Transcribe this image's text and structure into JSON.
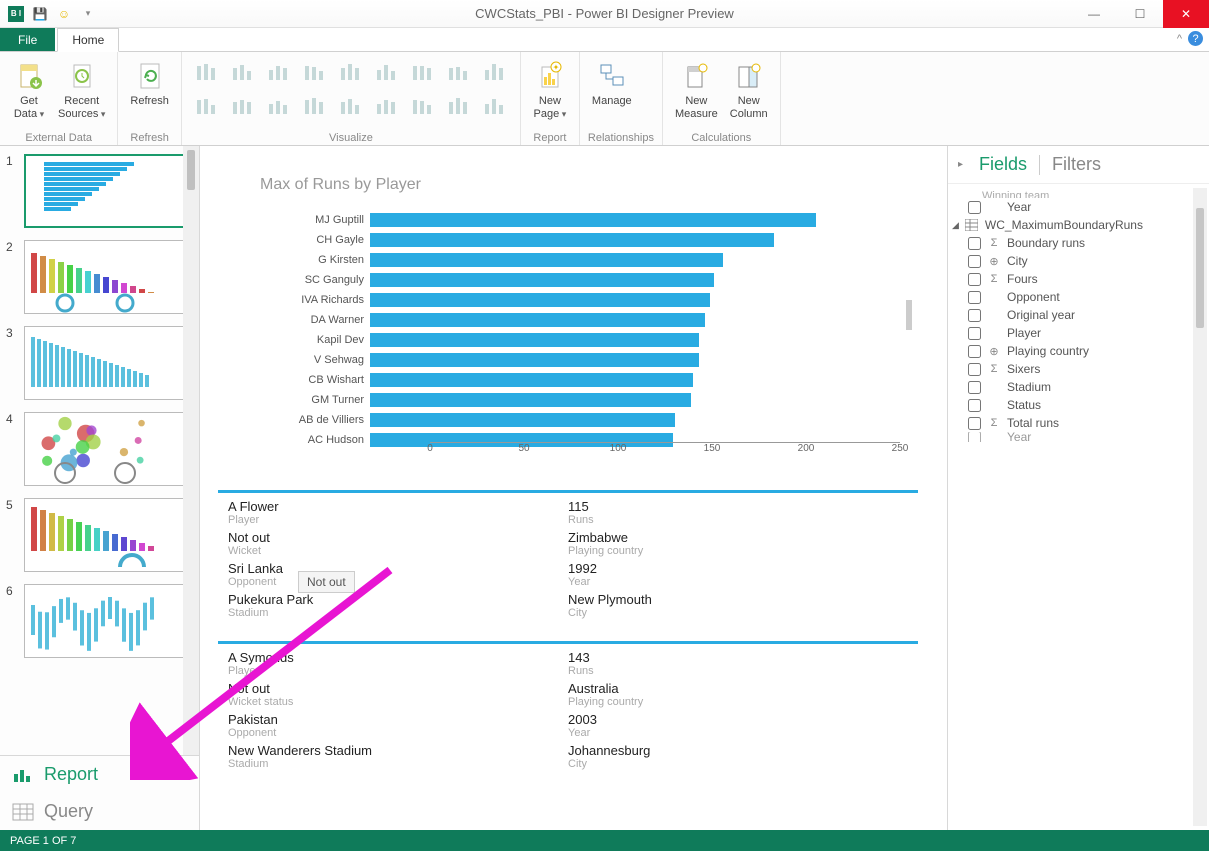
{
  "window": {
    "title": "CWCStats_PBI - Power BI Designer Preview"
  },
  "tabs": {
    "file": "File",
    "home": "Home"
  },
  "ribbon": {
    "external_data": {
      "label": "External Data",
      "get_data": "Get\nData",
      "recent_sources": "Recent\nSources"
    },
    "refresh": {
      "label": "Refresh",
      "btn": "Refresh"
    },
    "visualize": {
      "label": "Visualize"
    },
    "report": {
      "label": "Report",
      "new_page": "New\nPage"
    },
    "relationships": {
      "label": "Relationships",
      "manage": "Manage"
    },
    "calculations": {
      "label": "Calculations",
      "new_measure": "New\nMeasure",
      "new_column": "New\nColumn"
    }
  },
  "left_tabs": {
    "report": "Report",
    "query": "Query"
  },
  "thumbs": {
    "count": 6
  },
  "chart_data": {
    "type": "bar",
    "orientation": "horizontal",
    "title": "Max of Runs by Player",
    "xlabel": "",
    "ylabel": "",
    "xlim": [
      0,
      250
    ],
    "xticks": [
      0,
      50,
      100,
      150,
      200,
      250
    ],
    "categories": [
      "MJ Guptill",
      "CH Gayle",
      "G Kirsten",
      "SC Ganguly",
      "IVA Richards",
      "DA Warner",
      "Kapil Dev",
      "V Sehwag",
      "CB Wishart",
      "GM Turner",
      "AB de Villiers",
      "AC Hudson"
    ],
    "values": [
      237,
      215,
      188,
      183,
      181,
      178,
      175,
      175,
      172,
      171,
      162,
      161
    ]
  },
  "cards": [
    {
      "rows": [
        {
          "left_val": "A Flower",
          "left_key": "Player",
          "right_val": "115",
          "right_key": "Runs"
        },
        {
          "left_val": "Not out",
          "left_key": "Wicket",
          "right_val": "Zimbabwe",
          "right_key": "Playing country"
        },
        {
          "left_val": "Sri Lanka",
          "left_key": "Opponent",
          "right_val": "1992",
          "right_key": "Year"
        },
        {
          "left_val": "Pukekura Park",
          "left_key": "Stadium",
          "right_val": "New Plymouth",
          "right_key": "City"
        }
      ],
      "tooltip": "Not out"
    },
    {
      "rows": [
        {
          "left_val": "A Symonds",
          "left_key": "Player",
          "right_val": "143",
          "right_key": "Runs"
        },
        {
          "left_val": "Not out",
          "left_key": "Wicket status",
          "right_val": "Australia",
          "right_key": "Playing country"
        },
        {
          "left_val": "Pakistan",
          "left_key": "Opponent",
          "right_val": "2003",
          "right_key": "Year"
        },
        {
          "left_val": "New Wanderers Stadium",
          "left_key": "Stadium",
          "right_val": "Johannesburg",
          "right_key": "City"
        }
      ]
    }
  ],
  "right": {
    "fields_label": "Fields",
    "filters_label": "Filters",
    "partial_top": "Winning team",
    "year_top": "Year",
    "table": "WC_MaximumBoundaryRuns",
    "fields": [
      {
        "name": "Boundary runs",
        "icon": "sigma"
      },
      {
        "name": "City",
        "icon": "globe"
      },
      {
        "name": "Fours",
        "icon": "sigma"
      },
      {
        "name": "Opponent",
        "icon": ""
      },
      {
        "name": "Original year",
        "icon": ""
      },
      {
        "name": "Player",
        "icon": ""
      },
      {
        "name": "Playing country",
        "icon": "globe"
      },
      {
        "name": "Sixers",
        "icon": "sigma"
      },
      {
        "name": "Stadium",
        "icon": ""
      },
      {
        "name": "Status",
        "icon": ""
      },
      {
        "name": "Total runs",
        "icon": "sigma"
      },
      {
        "name": "Year",
        "icon": ""
      }
    ]
  },
  "status": "PAGE 1 OF 7"
}
